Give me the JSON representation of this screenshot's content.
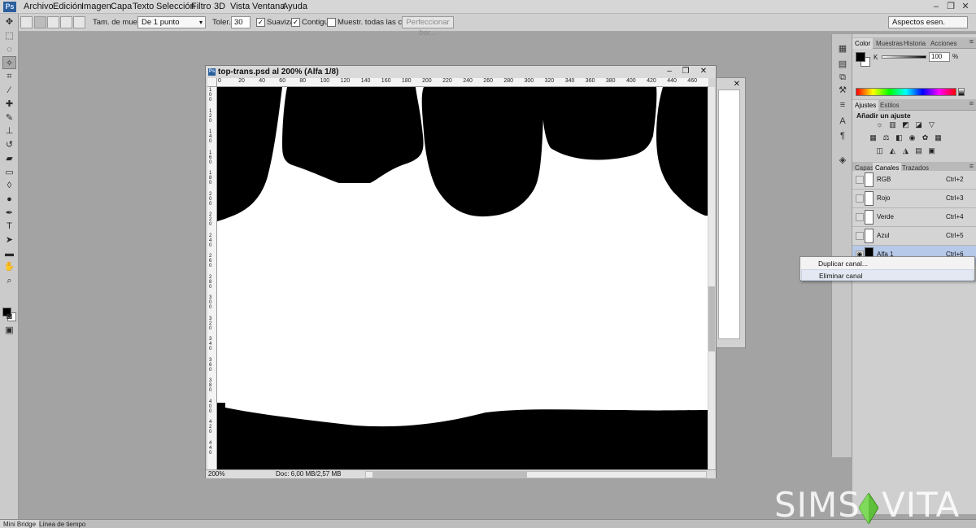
{
  "app": {
    "logo": "Ps"
  },
  "menu": [
    "Archivo",
    "Edición",
    "Imagen",
    "Capa",
    "Texto",
    "Selección",
    "Filtro",
    "3D",
    "Vista",
    "Ventana",
    "Ayuda"
  ],
  "window_controls": [
    "–",
    "❐",
    "✕"
  ],
  "options": {
    "sample_label": "Tam. de muestra:",
    "sample_value": "De 1 punto",
    "tolerance_label": "Toler.:",
    "tolerance_value": "30",
    "antialias_label": "Suavizar",
    "antialias_checked": true,
    "contiguous_label": "Contiguo",
    "contiguous_checked": true,
    "sample_all_label": "Muestr. todas las capas",
    "sample_all_checked": false,
    "refine_label": "Perfeccionar bor...",
    "workspace": "Aspectos esen."
  },
  "document": {
    "title": "top-trans.psd al 200% (Alfa 1/8)",
    "ruler_h": [
      "0",
      "20",
      "40",
      "60",
      "80",
      "100",
      "120",
      "140",
      "160",
      "180",
      "200",
      "220",
      "240",
      "260",
      "280",
      "300",
      "320",
      "340",
      "360",
      "380",
      "400",
      "420",
      "440",
      "460"
    ],
    "ruler_v": [
      "1 0 0",
      "1 2 0",
      "1 4 0",
      "1 6 0",
      "1 8 0",
      "2 0 0",
      "2 2 0",
      "2 4 0",
      "2 6 0",
      "2 8 0",
      "3 0 0",
      "3 2 0",
      "3 4 0",
      "3 6 0",
      "3 8 0",
      "4 0 0",
      "4 2 0",
      "4 4 0"
    ],
    "zoom": "200%",
    "doc_info": "Doc: 6,00 MB/2,57 MB"
  },
  "panels": {
    "color_tabs": [
      "Color",
      "Muestras",
      "Historia",
      "Acciones"
    ],
    "color_channel": "K",
    "color_value": "100",
    "color_unit": "%",
    "adjust_tabs": [
      "Ajustes",
      "Estilos"
    ],
    "adjust_title": "Añadir un ajuste",
    "layer_tabs": [
      "Capas",
      "Canales",
      "Trazados"
    ],
    "channels": [
      {
        "name": "RGB",
        "shortcut": "Ctrl+2",
        "selected": false
      },
      {
        "name": "Rojo",
        "shortcut": "Ctrl+3",
        "selected": false
      },
      {
        "name": "Verde",
        "shortcut": "Ctrl+4",
        "selected": false
      },
      {
        "name": "Azul",
        "shortcut": "Ctrl+5",
        "selected": false
      },
      {
        "name": "Alfa 1",
        "shortcut": "Ctrl+6",
        "selected": true
      }
    ]
  },
  "context_menu": {
    "items": [
      "Duplicar canal...",
      "Eliminar canal"
    ],
    "highlighted_index": 1
  },
  "bottom_tabs": [
    "Mini Bridge",
    "Línea de tiempo"
  ],
  "watermark": {
    "left": "SIMS",
    "right": "VITA"
  },
  "colors": {
    "workspace": "#a3a3a3",
    "selection_blue": "#b7c9e8",
    "watermark_green": "#5fbf3a"
  }
}
